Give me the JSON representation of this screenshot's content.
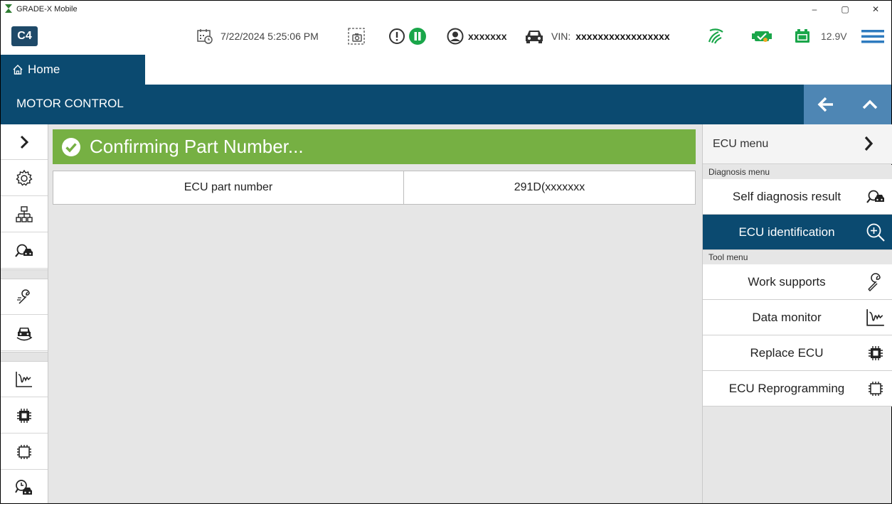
{
  "window": {
    "title": "GRADE-X Mobile",
    "controls": {
      "minimize": "–",
      "maximize": "▢",
      "close": "✕"
    }
  },
  "toolbar": {
    "logo": "C4",
    "datetime": "7/22/2024 5:25:06 PM",
    "user": "xxxxxxx",
    "vin_label": "VIN:",
    "vin_value": "xxxxxxxxxxxxxxxxx",
    "voltage": "12.9V",
    "icons": [
      "calendar-clock-icon",
      "screenshot-icon",
      "alert-icon",
      "pause-icon",
      "user-icon",
      "car-icon",
      "signal-icon",
      "vci-icon",
      "battery-icon",
      "hamburger-menu-icon"
    ],
    "colors": {
      "accent_green": "#1aa64a",
      "brand_blue": "#0b4a70"
    }
  },
  "nav": {
    "home_label": "Home"
  },
  "section": {
    "title": "MOTOR CONTROL"
  },
  "sidebar": {
    "icons": [
      "expand-chevron-icon",
      "settings-gear-icon",
      "network-topology-icon",
      "vehicle-search-icon",
      "work-support-wrench-icon",
      "vehicle-rotate-icon",
      "data-monitor-icon",
      "replace-ecu-chip-icon",
      "ecu-reprogram-chip-icon",
      "vehicle-history-icon"
    ]
  },
  "main": {
    "banner_text": "Confirming Part Number...",
    "table": {
      "label": "ECU part number",
      "value": "291D(xxxxxxx"
    }
  },
  "right_menu": {
    "header": "ECU menu",
    "diagnosis_caption": "Diagnosis menu",
    "tool_caption": "Tool menu",
    "diagnosis_items": [
      {
        "label": "Self diagnosis result",
        "icon": "vehicle-search-icon",
        "selected": false
      },
      {
        "label": "ECU identification",
        "icon": "zoom-in-icon",
        "selected": true
      }
    ],
    "tool_items": [
      {
        "label": "Work supports",
        "icon": "wrench-icon"
      },
      {
        "label": "Data monitor",
        "icon": "data-monitor-icon"
      },
      {
        "label": "Replace ECU",
        "icon": "chip-filled-icon"
      },
      {
        "label": "ECU Reprogramming",
        "icon": "chip-outline-icon"
      }
    ]
  }
}
